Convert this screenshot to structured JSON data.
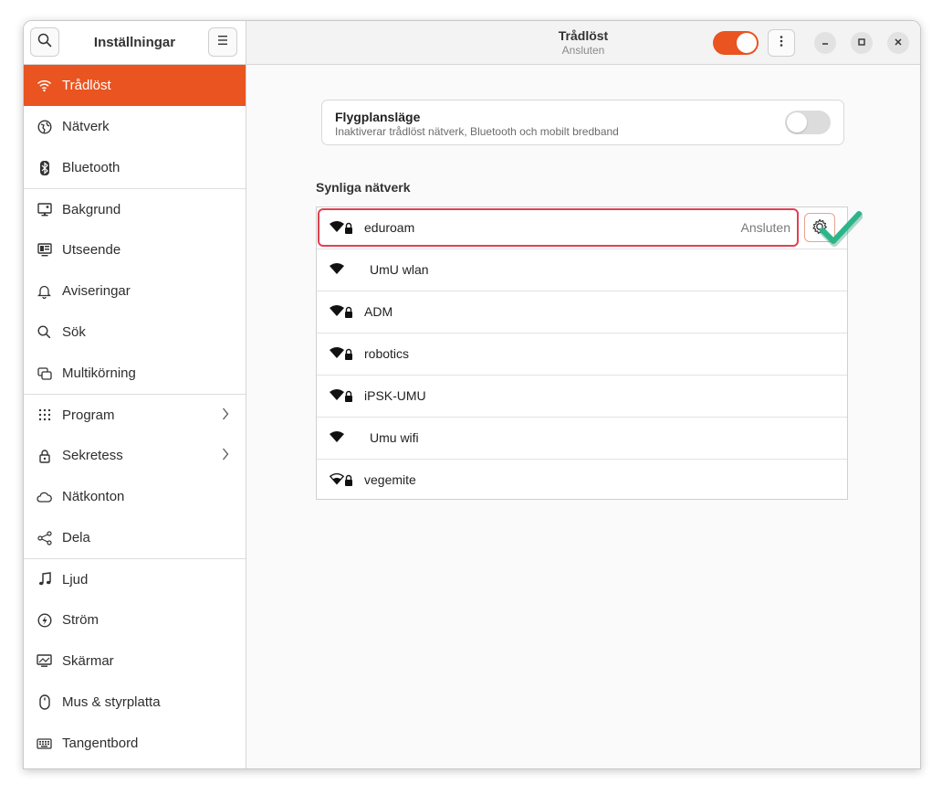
{
  "sidebar": {
    "title": "Inställningar",
    "items": [
      {
        "label": "Trådlöst",
        "icon": "wifi-icon"
      },
      {
        "label": "Nätverk",
        "icon": "network-icon"
      },
      {
        "label": "Bluetooth",
        "icon": "bluetooth-icon"
      },
      {
        "label": "Bakgrund",
        "icon": "background-icon"
      },
      {
        "label": "Utseende",
        "icon": "appearance-icon"
      },
      {
        "label": "Aviseringar",
        "icon": "bell-icon"
      },
      {
        "label": "Sök",
        "icon": "search-icon"
      },
      {
        "label": "Multikörning",
        "icon": "multitasking-icon"
      },
      {
        "label": "Program",
        "icon": "apps-grid-icon"
      },
      {
        "label": "Sekretess",
        "icon": "lock-icon"
      },
      {
        "label": "Nätkonton",
        "icon": "cloud-icon"
      },
      {
        "label": "Dela",
        "icon": "share-icon"
      },
      {
        "label": "Ljud",
        "icon": "music-note-icon"
      },
      {
        "label": "Ström",
        "icon": "power-icon"
      },
      {
        "label": "Skärmar",
        "icon": "display-icon"
      },
      {
        "label": "Mus & styrplatta",
        "icon": "mouse-icon"
      },
      {
        "label": "Tangentbord",
        "icon": "keyboard-icon"
      }
    ]
  },
  "header": {
    "title": "Trådlöst",
    "subtitle": "Ansluten"
  },
  "airplane": {
    "title": "Flygplansläge",
    "description": "Inaktiverar trådlöst nätverk, Bluetooth och mobilt bredband"
  },
  "networks": {
    "title": "Synliga nätverk",
    "items": [
      {
        "name": "eduroam",
        "status": "Ansluten",
        "locked": true
      },
      {
        "name": "UmU wlan",
        "locked": false
      },
      {
        "name": "ADM",
        "locked": true
      },
      {
        "name": "robotics",
        "locked": true
      },
      {
        "name": "iPSK-UMU",
        "locked": true
      },
      {
        "name": "Umu wifi",
        "locked": false
      },
      {
        "name": "vegemite",
        "locked": true
      }
    ]
  },
  "colors": {
    "accent": "#e95420",
    "highlight": "#e04150",
    "check": "#2cb58a"
  }
}
